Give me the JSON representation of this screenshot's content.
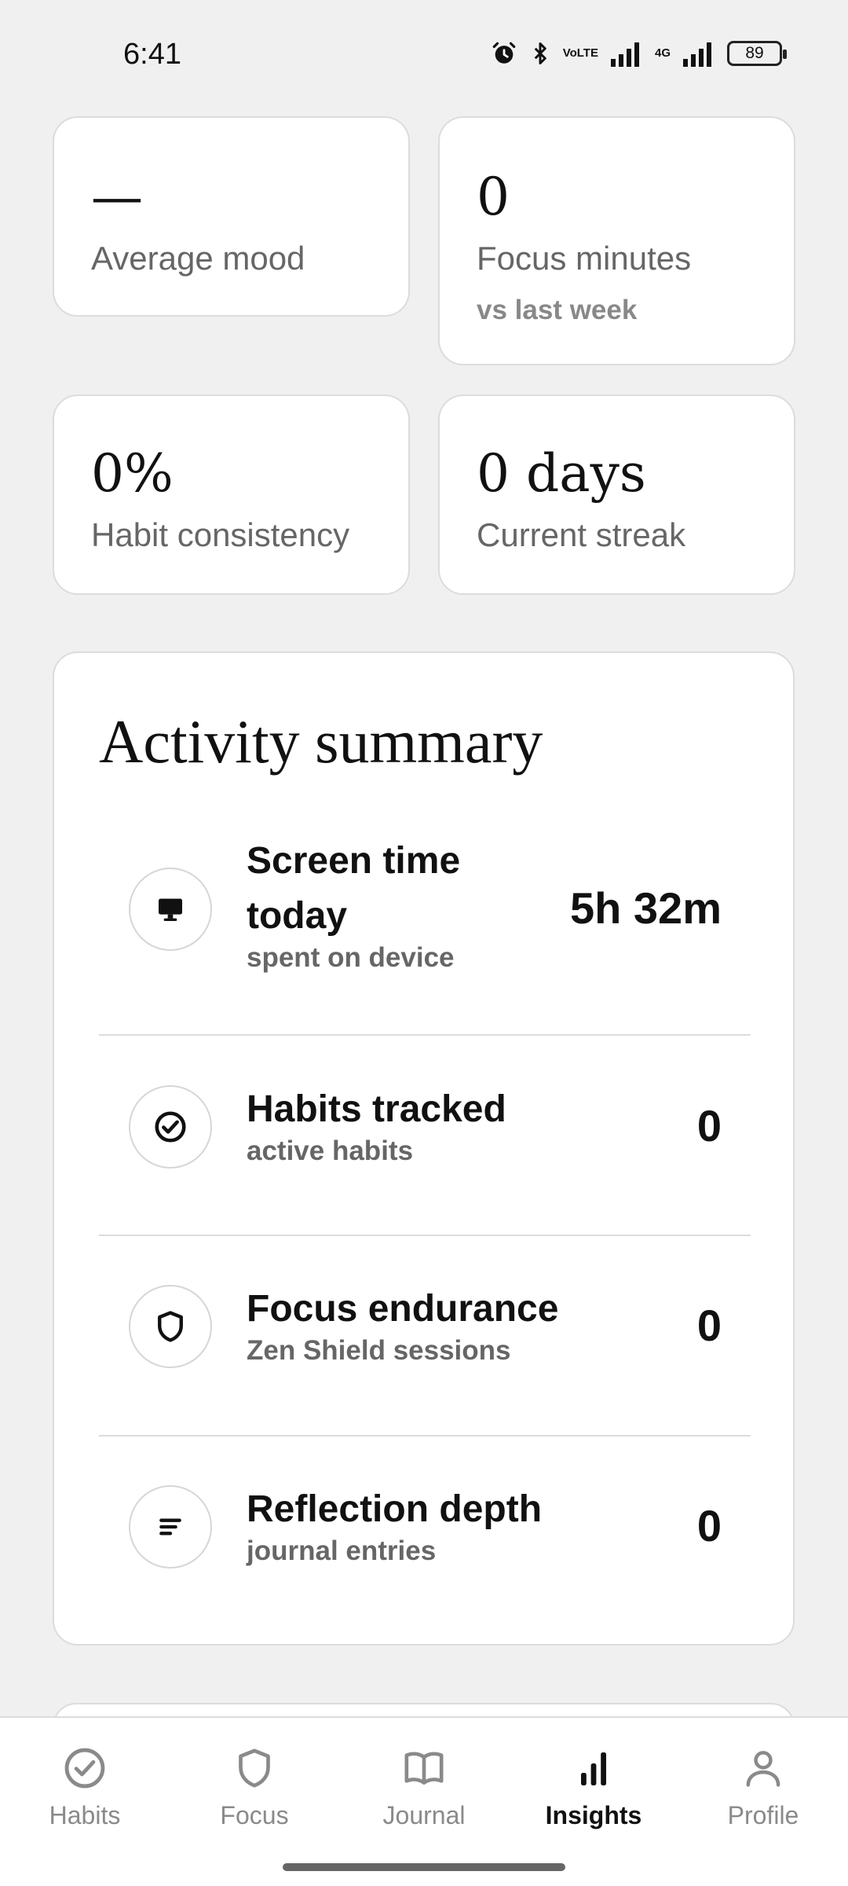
{
  "status_bar": {
    "time": "6:41",
    "network_label": "4G",
    "volte_label": "VoLTE",
    "battery": "89"
  },
  "stats": {
    "average_mood": {
      "value": "—",
      "label": "Average mood"
    },
    "focus_minutes": {
      "value": "0",
      "label": "Focus minutes",
      "sub": "vs last week"
    },
    "habit_consistency": {
      "value": "0%",
      "label": "Habit consistency"
    },
    "current_streak": {
      "value": "0 days",
      "label": "Current streak"
    }
  },
  "activity_summary": {
    "title": "Activity summary",
    "rows": [
      {
        "icon": "monitor-icon",
        "title": "Screen time",
        "title_line2": "today",
        "sub": "spent on device",
        "value": "5h 32m"
      },
      {
        "icon": "check-circle-icon",
        "title": "Habits tracked",
        "sub": "active habits",
        "value": "0"
      },
      {
        "icon": "shield-icon",
        "title": "Focus endurance",
        "sub": "Zen Shield sessions",
        "value": "0"
      },
      {
        "icon": "lines-icon",
        "title": "Reflection depth",
        "sub": "journal entries",
        "value": "0"
      }
    ]
  },
  "bottom_nav": {
    "active": "Insights",
    "items": [
      {
        "label": "Habits",
        "icon": "check-circle-icon"
      },
      {
        "label": "Focus",
        "icon": "shield-icon"
      },
      {
        "label": "Journal",
        "icon": "book-icon"
      },
      {
        "label": "Insights",
        "icon": "bar-chart-icon"
      },
      {
        "label": "Profile",
        "icon": "person-icon"
      }
    ]
  },
  "colors": {
    "background": "#f0f0f0",
    "card": "#ffffff",
    "border": "#dcdcdc",
    "text_primary": "#111111",
    "text_secondary": "#666666",
    "nav_inactive": "#8a8a8a"
  }
}
